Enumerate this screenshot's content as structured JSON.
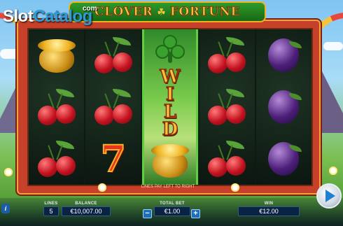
{
  "watermark": {
    "brand_left": "Slot",
    "brand_right": "Catalog",
    "com": "com"
  },
  "logo": {
    "word_left": "CLOVER",
    "word_right": "FORTUNE"
  },
  "reels": [
    [
      "pot-of-gold",
      "cherries",
      "cherries"
    ],
    [
      "cherries",
      "cherries",
      "seven"
    ],
    [
      "wild-expanded"
    ],
    [
      "cherries",
      "cherries",
      "cherries"
    ],
    [
      "plum",
      "plum",
      "plum"
    ]
  ],
  "wild_text": [
    "W",
    "I",
    "L",
    "D"
  ],
  "paylines_caption": "LINES PAY LEFT TO RIGHT",
  "controls": {
    "lines_label": "LINES",
    "lines_value": "5",
    "balance_label": "BALANCE",
    "balance_value": "€10,007.00",
    "total_bet_label": "TOTAL BET",
    "total_bet_value": "€1.00",
    "minus_label": "−",
    "plus_label": "+",
    "win_label": "WIN",
    "win_value": "€12.00",
    "info_label": "i"
  },
  "colors": {
    "frame": "#c7402a",
    "wild_gold": "#f6c33b",
    "control_bg": "#0b2342"
  }
}
